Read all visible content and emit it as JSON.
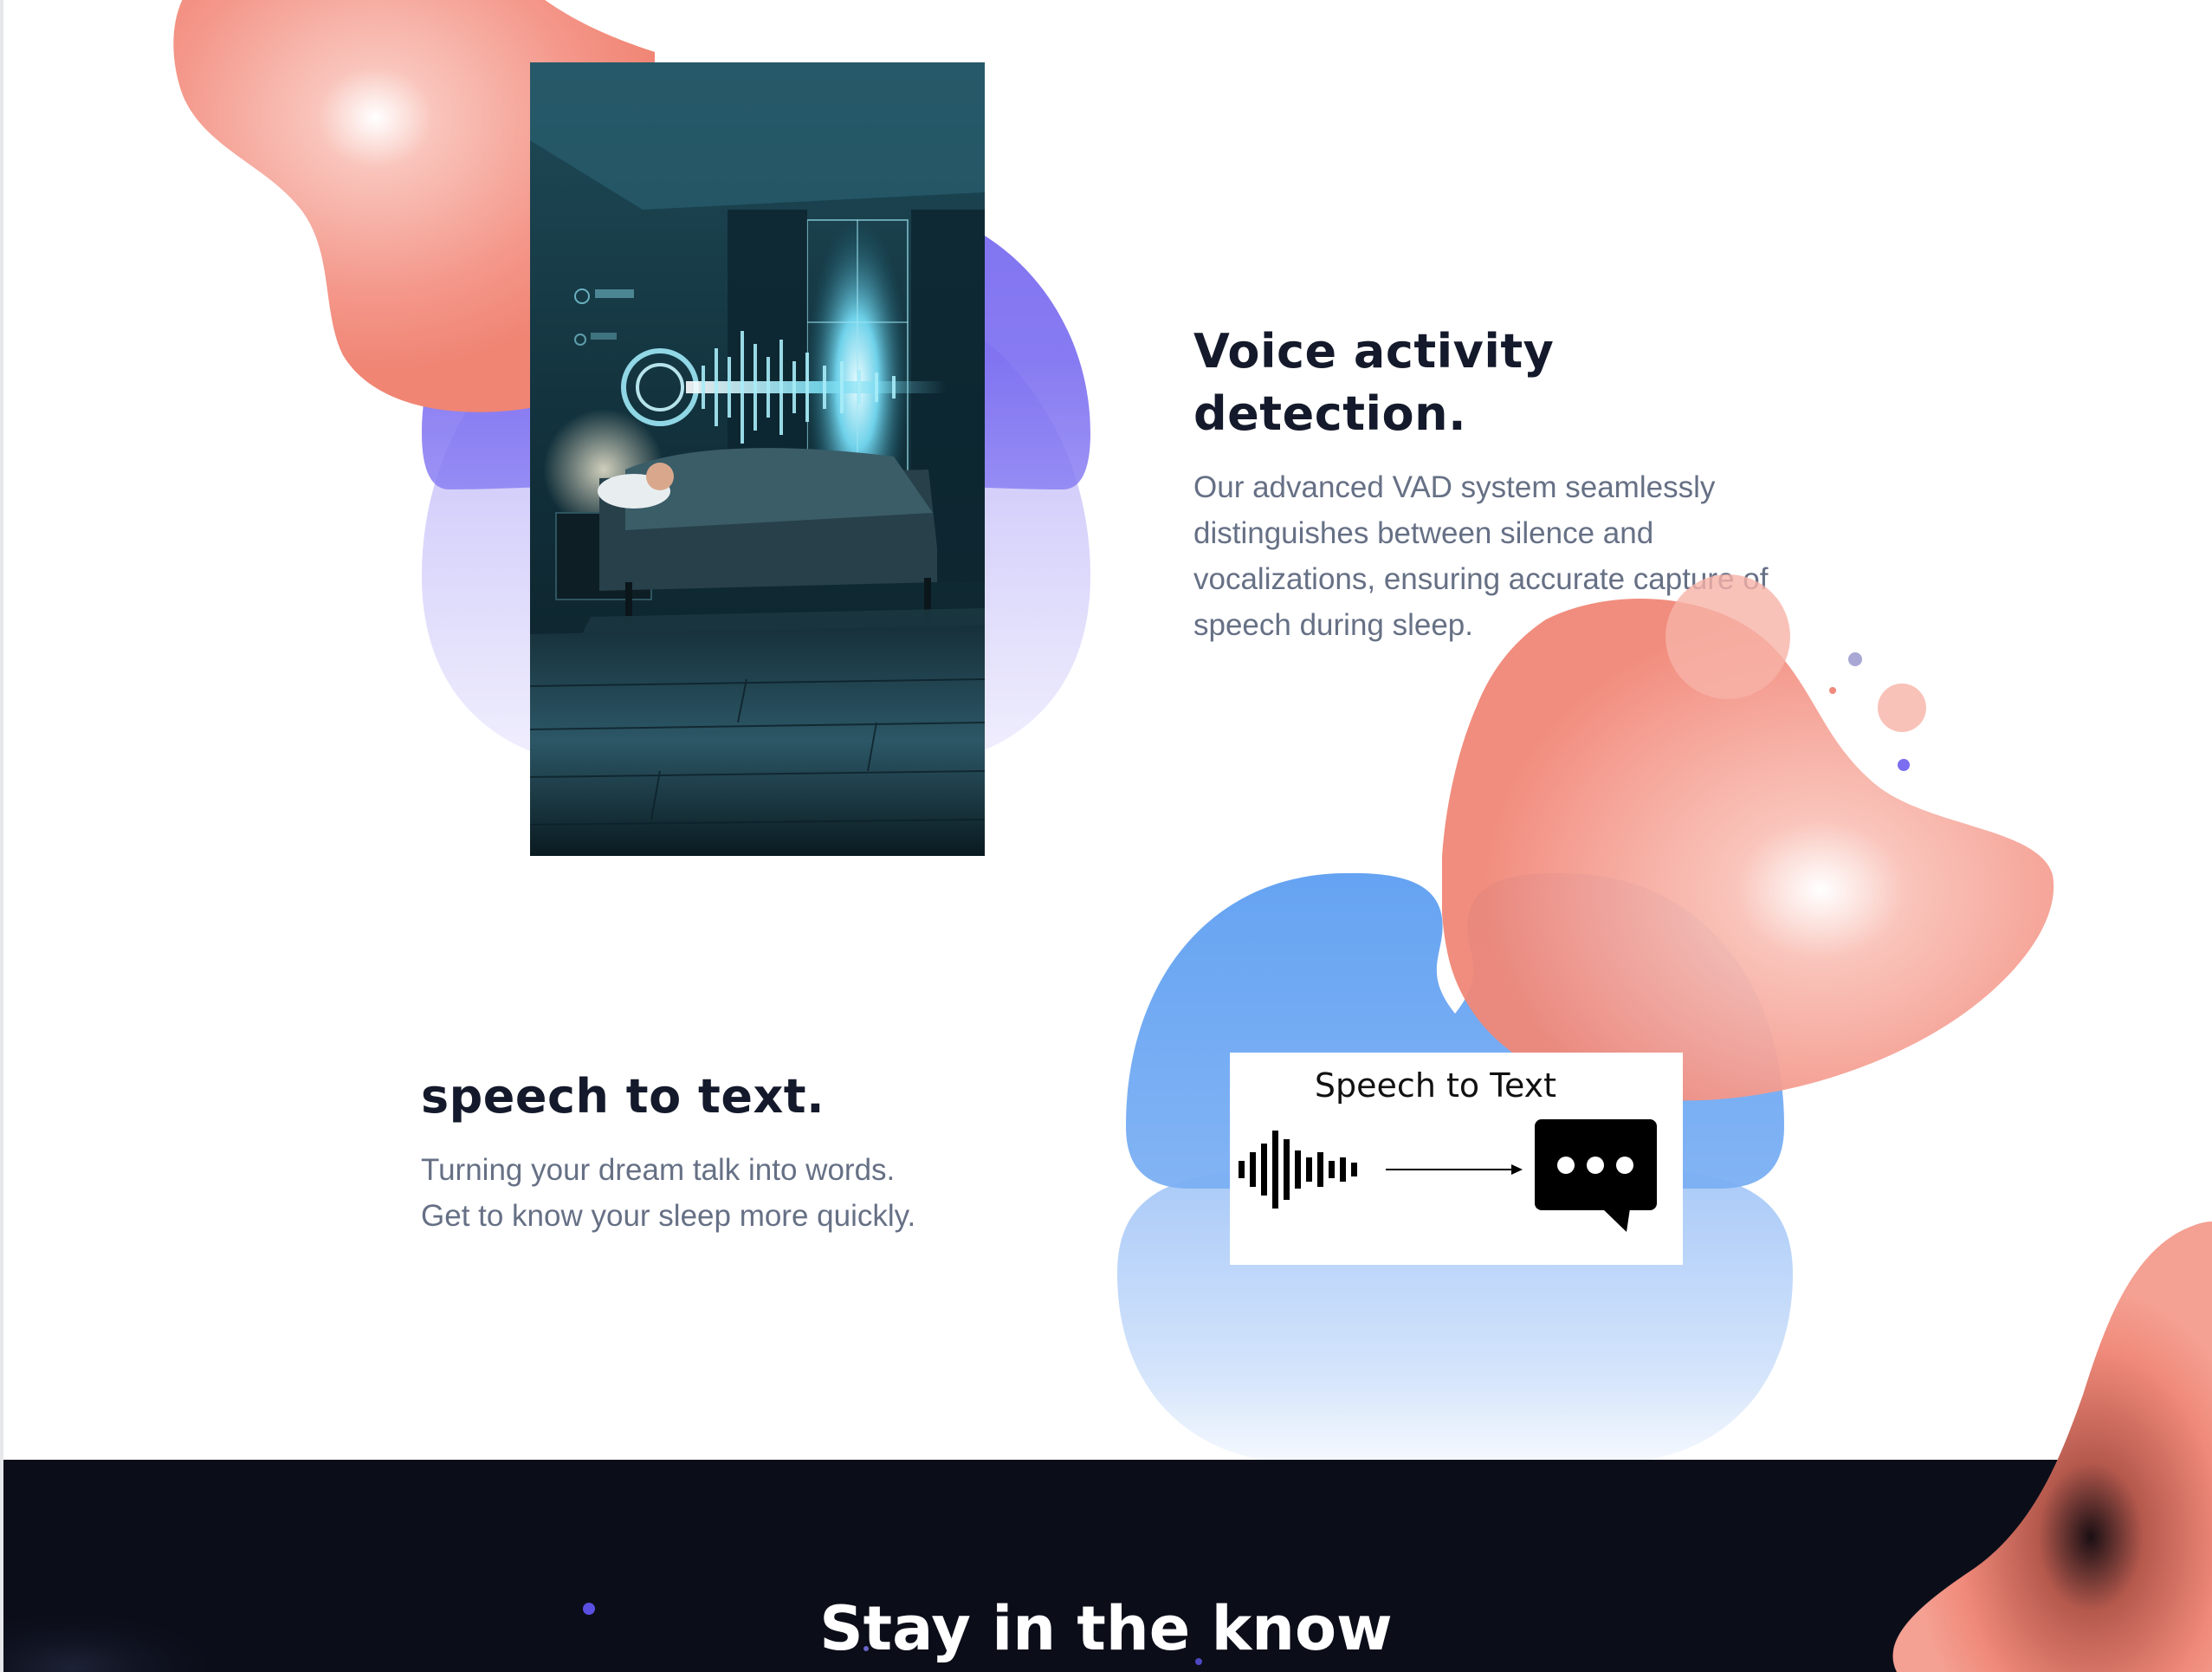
{
  "sections": [
    {
      "heading": "Voice activity detection.",
      "body_lines": [
        "Our advanced VAD system seamlessly",
        "distinguishes between silence and",
        "vocalizations, ensuring accurate capture of",
        "speech during sleep."
      ]
    },
    {
      "heading": "speech to text.",
      "body_lines": [
        "Turning your dream talk into words.",
        "Get to know your sleep more quickly."
      ]
    }
  ],
  "stt_card": {
    "title": "Speech to Text",
    "icons": [
      "sound-wave-icon",
      "arrow-right-icon",
      "chat-bubble-ellipsis-icon"
    ]
  },
  "footer": {
    "title": "Stay in the know"
  },
  "colors": {
    "heading": "#141a2b",
    "body": "#667085",
    "coral": "#f38a7c",
    "purple": "#7b6ef0",
    "blue": "#5b9bf0",
    "dark_band": "#0b0e19"
  }
}
